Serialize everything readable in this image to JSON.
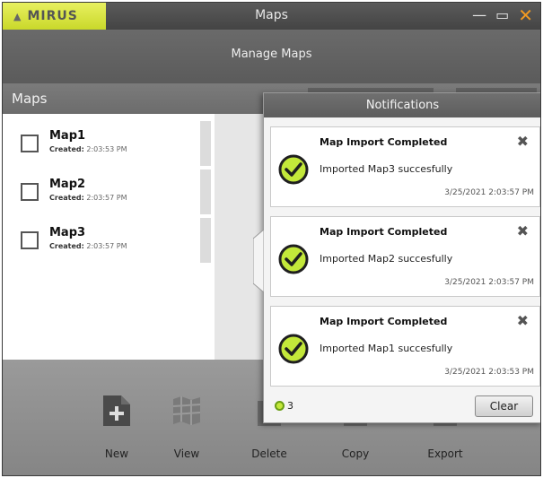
{
  "window": {
    "brand": "MIRUS",
    "title": "Maps",
    "controls": [
      "minimize-icon",
      "maximize-icon",
      "close-icon"
    ]
  },
  "header": {
    "title": "Manage Maps"
  },
  "maps_bar": {
    "title": "Maps"
  },
  "maps": [
    {
      "name": "Map1",
      "created_label": "Created:",
      "created_time": "2:03:53 PM"
    },
    {
      "name": "Map2",
      "created_label": "Created:",
      "created_time": "2:03:57 PM"
    },
    {
      "name": "Map3",
      "created_label": "Created:",
      "created_time": "2:03:57 PM"
    }
  ],
  "toolbar": {
    "new_label": "New",
    "view_label": "View",
    "delete_label": "Delete",
    "copy_label": "Copy",
    "export_label": "Export"
  },
  "notifications": {
    "title": "Notifications",
    "items": [
      {
        "title": "Map Import Completed",
        "message": "Imported Map3 succesfully",
        "timestamp": "3/25/2021 2:03:57 PM"
      },
      {
        "title": "Map Import Completed",
        "message": "Imported Map2 succesfully",
        "timestamp": "3/25/2021 2:03:57 PM"
      },
      {
        "title": "Map Import Completed",
        "message": "Imported Map1 succesfully",
        "timestamp": "3/25/2021 2:03:53 PM"
      }
    ],
    "count": "3",
    "clear_label": "Clear"
  },
  "colors": {
    "brand_yellow": "#d7e23a",
    "close_orange": "#f39a21",
    "success_green": "#c3e83a"
  }
}
